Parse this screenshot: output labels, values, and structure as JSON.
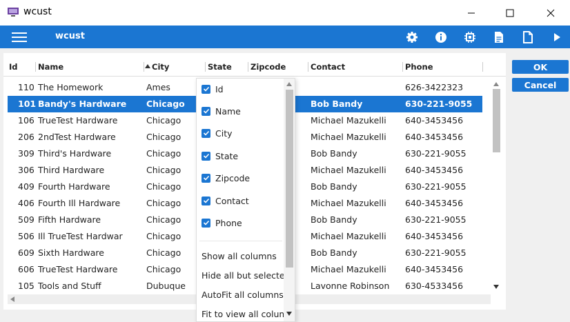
{
  "window": {
    "title": "wcust"
  },
  "appbar": {
    "title": "wcust"
  },
  "columns": [
    "Id",
    "Name",
    "City",
    "State",
    "Zipcode",
    "Contact",
    "Phone"
  ],
  "rows": [
    {
      "id": "110",
      "name": "The Homework",
      "city": "Ames",
      "contact": "",
      "phone": "626-3422323",
      "selected": false
    },
    {
      "id": "101",
      "name": "Bandy's Hardware",
      "city": "Chicago",
      "contact": "Bob Bandy",
      "phone": "630-221-9055",
      "selected": true
    },
    {
      "id": "106",
      "name": "TrueTest Hardware",
      "city": "Chicago",
      "contact": "Michael Mazukelli",
      "phone": "640-3453456",
      "selected": false
    },
    {
      "id": "206",
      "name": "2ndTest Hardware",
      "city": "Chicago",
      "contact": "Michael Mazukelli",
      "phone": "640-3453456",
      "selected": false
    },
    {
      "id": "309",
      "name": "Third's Hardware",
      "city": "Chicago",
      "contact": "Bob Bandy",
      "phone": "630-221-9055",
      "selected": false
    },
    {
      "id": "306",
      "name": "Third Hardware",
      "city": "Chicago",
      "contact": "Michael Mazukelli",
      "phone": "640-3453456",
      "selected": false
    },
    {
      "id": "409",
      "name": "Fourth Hardware",
      "city": "Chicago",
      "contact": "Bob Bandy",
      "phone": "630-221-9055",
      "selected": false
    },
    {
      "id": "406",
      "name": "Fourth Ill Hardware",
      "city": "Chicago",
      "contact": "Michael Mazukelli",
      "phone": "640-3453456",
      "selected": false
    },
    {
      "id": "509",
      "name": "Fifth Hardware",
      "city": "Chicago",
      "contact": "Bob Bandy",
      "phone": "630-221-9055",
      "selected": false
    },
    {
      "id": "506",
      "name": "Ill TrueTest Hardwar",
      "city": "Chicago",
      "contact": "Michael Mazukelli",
      "phone": "640-3453456",
      "selected": false
    },
    {
      "id": "609",
      "name": "Sixth Hardware",
      "city": "Chicago",
      "contact": "Bob Bandy",
      "phone": "630-221-9055",
      "selected": false
    },
    {
      "id": "606",
      "name": "TrueTest Hardware",
      "city": "Chicago",
      "contact": "Michael Mazukelli",
      "phone": "640-3453456",
      "selected": false
    },
    {
      "id": "105",
      "name": "Tools and Stuff",
      "city": "Dubuque",
      "contact": "Lavonne Robinson",
      "phone": "630-4533456",
      "selected": false
    }
  ],
  "column_menu": {
    "checkboxes": [
      {
        "label": "Id",
        "checked": true
      },
      {
        "label": "Name",
        "checked": true
      },
      {
        "label": "City",
        "checked": true
      },
      {
        "label": "State",
        "checked": true
      },
      {
        "label": "Zipcode",
        "checked": true
      },
      {
        "label": "Contact",
        "checked": true
      },
      {
        "label": "Phone",
        "checked": true
      }
    ],
    "actions": [
      "Show all columns",
      "Hide all but selected",
      "AutoFit all columns",
      "Fit to view all columns"
    ]
  },
  "buttons": {
    "ok": "OK",
    "cancel": "Cancel"
  },
  "colors": {
    "accent": "#1b76d2"
  },
  "icons": [
    "app-icon",
    "minimize-icon",
    "maximize-icon",
    "close-icon",
    "hamburger-icon",
    "gear-icon",
    "info-icon",
    "chip-icon",
    "document-icon",
    "blank-document-icon",
    "play-icon",
    "sort-ascending-icon",
    "check-icon",
    "scroll-up-icon",
    "scroll-down-icon",
    "scroll-left-icon"
  ]
}
